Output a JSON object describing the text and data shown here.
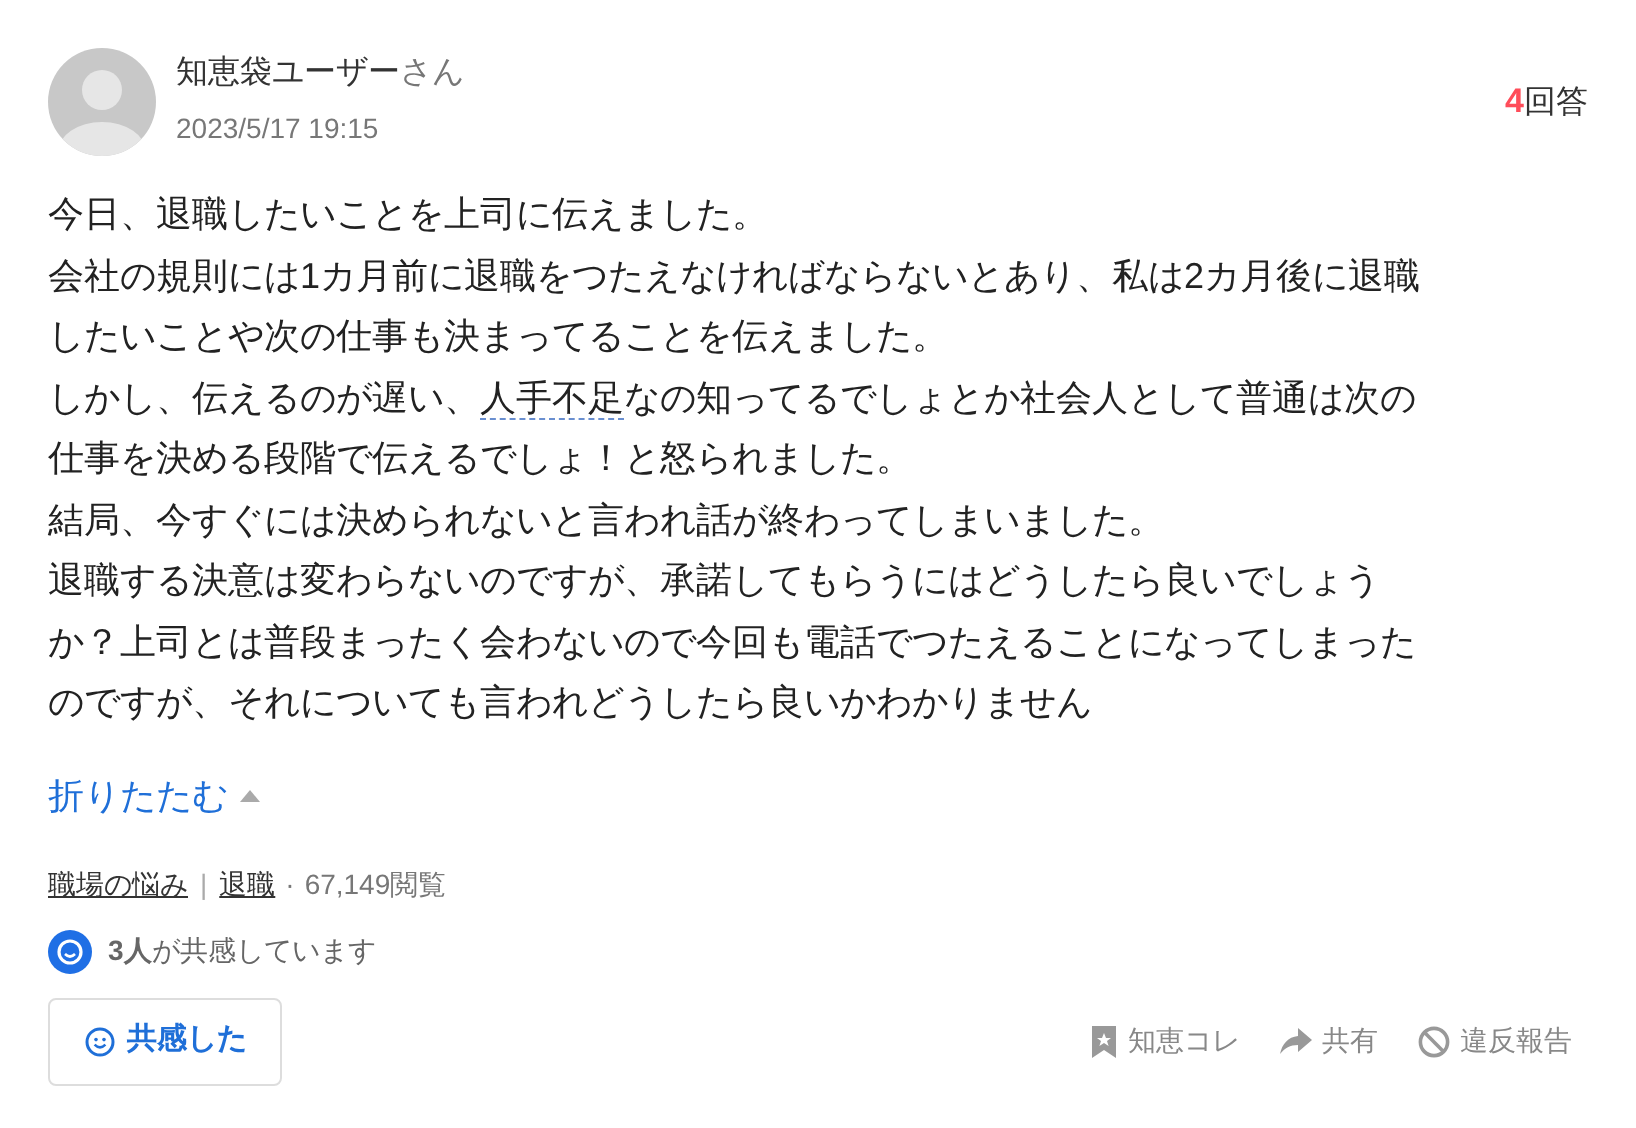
{
  "question": {
    "user_name": "知恵袋ユーザー",
    "honorific": "さん",
    "date": "2023/5/17 19:15",
    "answer_count": "4",
    "answer_label": "回答",
    "body_lines": [
      [
        {
          "kind": "text",
          "text": "今日、退職したいことを上司に伝えました。"
        }
      ],
      [
        {
          "kind": "text",
          "text": "会社の規則には1カ月前に退職をつたえなければならないとあり、私は2カ月後に退職"
        }
      ],
      [
        {
          "kind": "text",
          "text": "したいことや次の仕事も決まってることを伝えました。"
        }
      ],
      [
        {
          "kind": "text",
          "text": "しかし、伝えるのが遅い、"
        },
        {
          "kind": "keyword",
          "text": "人手不足"
        },
        {
          "kind": "text",
          "text": "なの知ってるでしょとか社会人として普通は次の"
        }
      ],
      [
        {
          "kind": "text",
          "text": "仕事を決める段階で伝えるでしょ！と怒られました。"
        }
      ],
      [
        {
          "kind": "text",
          "text": "結局、今すぐには決められないと言われ話が終わってしまいました。"
        }
      ],
      [
        {
          "kind": "text",
          "text": "退職する決意は変わらないのですが、承諾してもらうにはどうしたら良いでしょう"
        }
      ],
      [
        {
          "kind": "text",
          "text": "か？上司とは普段まったく会わないので今回も電話でつたえることになってしまった"
        }
      ],
      [
        {
          "kind": "text",
          "text": "のですが、それについても言われどうしたら良いかわかりません"
        }
      ]
    ],
    "collapse_toggle": {
      "label": "折りたたむ",
      "expanded": true
    },
    "categories": [
      "職場の悩み",
      "退職"
    ],
    "category_separator": "|",
    "views_separator": "·",
    "views": "67,149閲覧",
    "empathy_summary": "**3人**が共感しています",
    "empathy_button": "共感した",
    "actions": [
      {
        "kind": "bookmark",
        "label": "知恵コレ"
      },
      {
        "kind": "share",
        "label": "共有"
      },
      {
        "kind": "report",
        "label": "違反報告"
      }
    ]
  }
}
